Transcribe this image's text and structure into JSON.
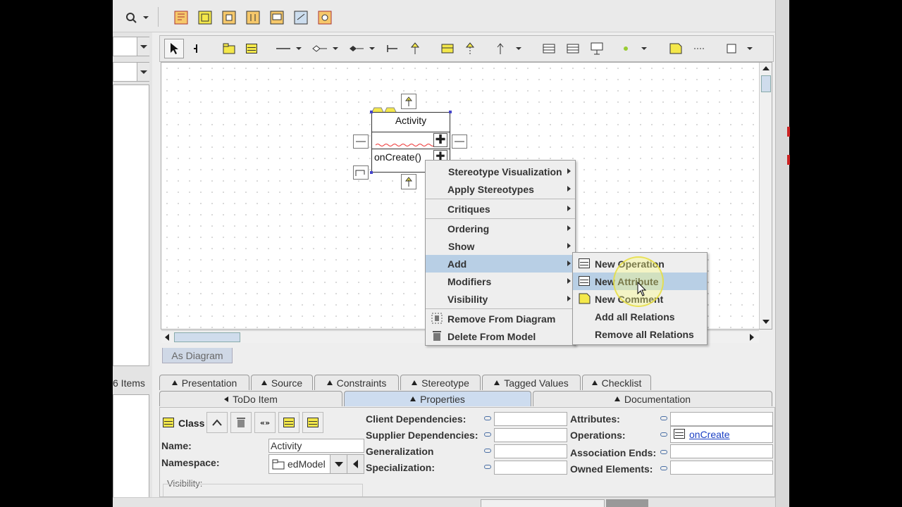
{
  "diagram": {
    "class_name": "Activity",
    "operation": "onCreate()",
    "tab_label": "As Diagram"
  },
  "context_menu": {
    "items": [
      {
        "label": "Stereotype Visualization",
        "submenu": true
      },
      {
        "label": "Apply Stereotypes",
        "submenu": true
      },
      {
        "label": "Critiques",
        "submenu": true
      },
      {
        "label": "Ordering",
        "submenu": true
      },
      {
        "label": "Show",
        "submenu": true
      },
      {
        "label": "Add",
        "submenu": true,
        "highlighted": true
      },
      {
        "label": "Modifiers",
        "submenu": true
      },
      {
        "label": "Visibility",
        "submenu": true
      },
      {
        "label": "Remove From Diagram",
        "icon": "remove-diagram-icon"
      },
      {
        "label": "Delete From Model",
        "icon": "trash-icon"
      }
    ]
  },
  "add_submenu": {
    "items": [
      {
        "label": "New Operation",
        "icon": "operation-icon"
      },
      {
        "label": "New Attribute",
        "icon": "attribute-icon",
        "highlighted": true
      },
      {
        "label": "New Comment",
        "icon": "comment-icon"
      },
      {
        "label": "Add all Relations"
      },
      {
        "label": "Remove all Relations"
      }
    ]
  },
  "left_panel": {
    "items_count": "6 Items"
  },
  "tabs_row1": [
    "Presentation",
    "Source",
    "Constraints",
    "Stereotype",
    "Tagged Values",
    "Checklist"
  ],
  "tabs_row2": [
    "ToDo Item",
    "Properties",
    "Documentation"
  ],
  "properties": {
    "type_label": "Class",
    "name_label": "Name:",
    "name_value": "Activity",
    "namespace_label": "Namespace:",
    "namespace_value": "edModel",
    "visibility_label": "Visibility:",
    "client_deps": "Client Dependencies:",
    "supplier_deps": "Supplier Dependencies:",
    "generalization": "Generalization",
    "specialization": "Specialization:",
    "attributes": "Attributes:",
    "operations": "Operations:",
    "operations_value": "onCreate",
    "association_ends": "Association Ends:",
    "owned_elements": "Owned Elements:"
  },
  "colors": {
    "highlight": "#b8cfe5",
    "class_yellow": "#f4e84b",
    "link_blue": "#1a3fc4"
  }
}
